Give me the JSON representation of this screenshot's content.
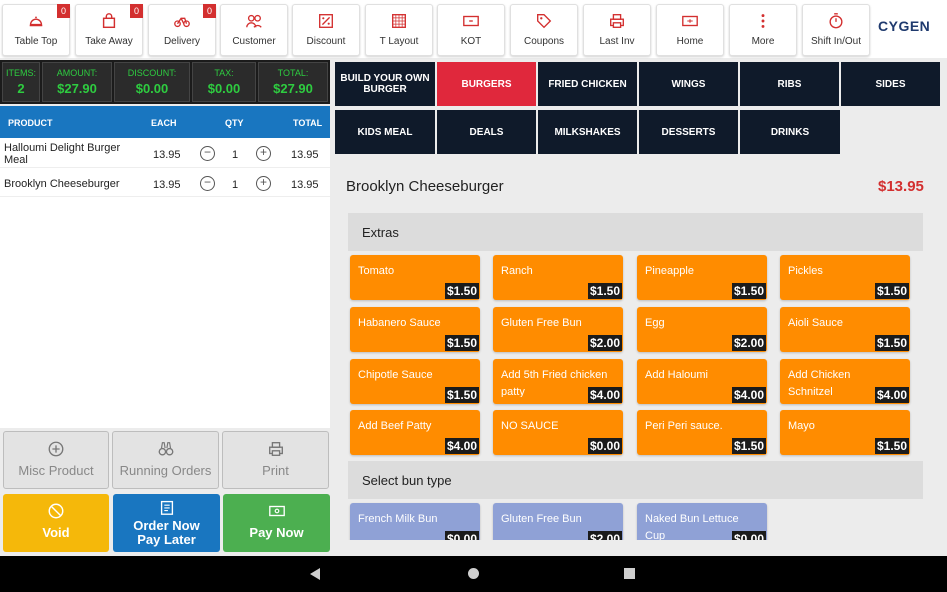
{
  "toolbar": {
    "buttons": [
      {
        "label": "Table Top",
        "icon": "cloche-icon",
        "badge": "0"
      },
      {
        "label": "Take Away",
        "icon": "bag-icon",
        "badge": "0"
      },
      {
        "label": "Delivery",
        "icon": "bike-icon",
        "badge": "0"
      },
      {
        "label": "Customer",
        "icon": "users-icon"
      },
      {
        "label": "Discount",
        "icon": "percent-icon"
      },
      {
        "label": "T Layout",
        "icon": "grid-icon"
      },
      {
        "label": "KOT",
        "icon": "ticket-icon"
      },
      {
        "label": "Coupons",
        "icon": "tag-icon"
      },
      {
        "label": "Last Inv",
        "icon": "printer-icon"
      },
      {
        "label": "Home",
        "icon": "home-icon"
      },
      {
        "label": "More",
        "icon": "more-vertical-icon"
      },
      {
        "label": "Shift In/Out",
        "icon": "stopwatch-icon"
      }
    ],
    "logo": "CYGEN"
  },
  "summary": {
    "items_label": "ITEMS:",
    "items": "2",
    "amount_label": "AMOUNT:",
    "amount": "$27.90",
    "discount_label": "DISCOUNT:",
    "discount": "$0.00",
    "tax_label": "TAX:",
    "tax": "$0.00",
    "total_label": "TOTAL:",
    "total": "$27.90"
  },
  "order": {
    "headers": {
      "product": "PRODUCT",
      "each": "EACH",
      "qty": "QTY",
      "total": "TOTAL"
    },
    "rows": [
      {
        "name": "Halloumi Delight Burger Meal",
        "each": "13.95",
        "qty": "1",
        "total": "13.95"
      },
      {
        "name": "Brooklyn Cheeseburger",
        "each": "13.95",
        "qty": "1",
        "total": "13.95"
      }
    ]
  },
  "actions": {
    "misc": "Misc Product",
    "running": "Running Orders",
    "print": "Print",
    "void": "Void",
    "order_now_1": "Order Now",
    "order_now_2": "Pay Later",
    "pay_now": "Pay Now"
  },
  "categories": [
    {
      "label": "BUILD YOUR OWN BURGER"
    },
    {
      "label": "BURGERS",
      "active": true
    },
    {
      "label": "FRIED CHICKEN"
    },
    {
      "label": "WINGS"
    },
    {
      "label": "RIBS"
    },
    {
      "label": "SIDES"
    },
    {
      "label": "KIDS MEAL"
    },
    {
      "label": "DEALS"
    },
    {
      "label": "MILKSHAKES"
    },
    {
      "label": "DESSERTS"
    },
    {
      "label": "DRINKS"
    }
  ],
  "item": {
    "name": "Brooklyn Cheeseburger",
    "price": "$13.95",
    "sections": [
      {
        "title": "Extras"
      },
      {
        "title": "Select bun type"
      }
    ],
    "extras": [
      {
        "name": "Tomato",
        "price": "$1.50"
      },
      {
        "name": "Ranch",
        "price": "$1.50"
      },
      {
        "name": "Pineapple",
        "price": "$1.50"
      },
      {
        "name": "Pickles",
        "price": "$1.50"
      },
      {
        "name": "Habanero Sauce",
        "price": "$1.50"
      },
      {
        "name": "Gluten Free Bun",
        "price": "$2.00"
      },
      {
        "name": "Egg",
        "price": "$2.00"
      },
      {
        "name": "Aioli Sauce",
        "price": "$1.50"
      },
      {
        "name": "Chipotle Sauce",
        "price": "$1.50"
      },
      {
        "name": "Add 5th Fried chicken patty",
        "price": "$4.00"
      },
      {
        "name": "Add Haloumi",
        "price": "$4.00"
      },
      {
        "name": "Add Chicken Schnitzel",
        "price": "$4.00"
      },
      {
        "name": "Add Beef Patty",
        "price": "$4.00"
      },
      {
        "name": "NO SAUCE",
        "price": "$0.00"
      },
      {
        "name": "Peri Peri sauce.",
        "price": "$1.50"
      },
      {
        "name": "Mayo",
        "price": "$1.50"
      }
    ],
    "buns": [
      {
        "name": "French Milk Bun",
        "price": "$0.00"
      },
      {
        "name": "Gluten Free Bun",
        "price": "$2.00"
      },
      {
        "name": "Naked Bun Lettuce Cup",
        "price": "$0.00"
      }
    ]
  },
  "colors": {
    "accent": "#e0283c",
    "category_bg": "#0f1a2a",
    "option": "#ff8c00",
    "bun_option": "#8fa1d6",
    "header_blue": "#1976c0",
    "summary_green": "#2ecc40"
  }
}
